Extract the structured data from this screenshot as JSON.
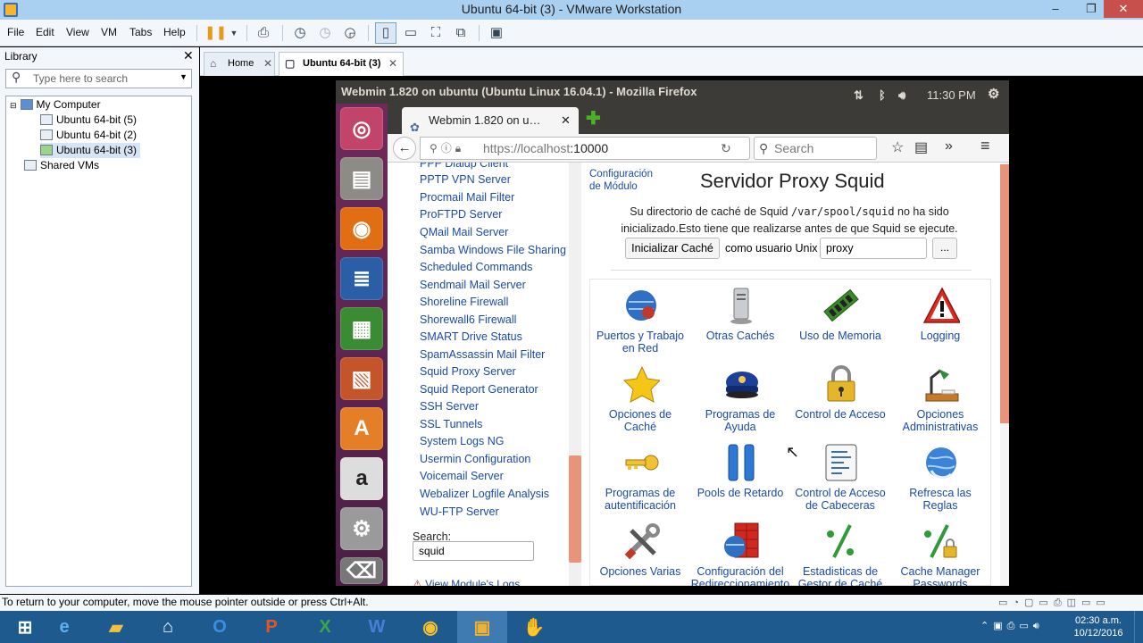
{
  "vmware": {
    "title": "Ubuntu 64-bit (3) - VMware Workstation",
    "menu": [
      "File",
      "Edit",
      "View",
      "VM",
      "Tabs",
      "Help"
    ],
    "library": {
      "header": "Library",
      "search_placeholder": "Type here to search",
      "tree": [
        "My Computer",
        "Ubuntu 64-bit (5)",
        "Ubuntu 64-bit (2)",
        "Ubuntu 64-bit (3)",
        "Shared VMs"
      ]
    },
    "tabs": [
      {
        "label": "Home"
      },
      {
        "label": "Ubuntu 64-bit (3)"
      }
    ],
    "status": "To return to your computer, move the mouse pointer outside or press Ctrl+Alt."
  },
  "guest": {
    "window_title": "Webmin 1.820 on ubuntu (Ubuntu Linux 16.04.1) - Mozilla Firefox",
    "time": "11:30 PM",
    "tab_title": "Webmin 1.820 on u…",
    "url_host": "https://localhost",
    "url_port": ":10000",
    "search_placeholder": "Search"
  },
  "webmin": {
    "modules": [
      "PPP Dialup Client",
      "PPTP VPN Server",
      "Procmail Mail Filter",
      "ProFTPD Server",
      "QMail Mail Server",
      "Samba Windows File Sharing",
      "Scheduled Commands",
      "Sendmail Mail Server",
      "Shoreline Firewall",
      "Shorewall6 Firewall",
      "SMART Drive Status",
      "SpamAssassin Mail Filter",
      "Squid Proxy Server",
      "Squid Report Generator",
      "SSH Server",
      "SSL Tunnels",
      "System Logs NG",
      "Usermin Configuration",
      "Voicemail Server",
      "Webalizer Logfile Analysis",
      "WU-FTP Server"
    ],
    "search_label": "Search:",
    "search_value": "squid",
    "view_logs": "View Module's Logs",
    "config_link_1": "Configuración",
    "config_link_2": "de Módulo",
    "page_title": "Servidor Proxy Squid",
    "warning_1": "Su directorio de caché de Squid",
    "warning_path": "/var/spool/squid",
    "warning_2": "no ha sido inicializado.Esto tiene que realizarse antes de que Squid se ejecute.",
    "init_button": "Inicializar Caché",
    "as_user": "como usuario Unix",
    "user_value": "proxy",
    "dots": "...",
    "icons": [
      {
        "l1": "Puertos y Trabajo",
        "l2": "en Red",
        "icon": "network-icon"
      },
      {
        "l1": "Otras Cachés",
        "l2": "",
        "icon": "server-icon"
      },
      {
        "l1": "Uso de Memoria",
        "l2": "",
        "icon": "memory-icon"
      },
      {
        "l1": "Logging",
        "l2": "",
        "icon": "warning-icon"
      },
      {
        "l1": "Opciones de",
        "l2": "Caché",
        "icon": "star-icon"
      },
      {
        "l1": "Programas de",
        "l2": "Ayuda",
        "icon": "police-hat-icon"
      },
      {
        "l1": "Control de Acceso",
        "l2": "",
        "icon": "lock-icon"
      },
      {
        "l1": "Opciones",
        "l2": "Administrativas",
        "icon": "desk-lamp-icon"
      },
      {
        "l1": "Programas de",
        "l2": "autentificación",
        "icon": "key-icon"
      },
      {
        "l1": "Pools de Retardo",
        "l2": "",
        "icon": "pause-pools-icon"
      },
      {
        "l1": "Control de Acceso",
        "l2": "de Cabeceras",
        "icon": "document-icon"
      },
      {
        "l1": "Refresca las",
        "l2": "Reglas",
        "icon": "globe-refresh-icon"
      },
      {
        "l1": "Opciones Varias",
        "l2": "",
        "icon": "tools-icon"
      },
      {
        "l1": "Configuración del",
        "l2": "Redireccionamiento",
        "icon": "redirect-icon"
      },
      {
        "l1": "Estadisticas de",
        "l2": "Gestor de Caché",
        "icon": "stats-icon"
      },
      {
        "l1": "Cache Manager",
        "l2": "Passwords",
        "icon": "cache-lock-icon"
      }
    ]
  },
  "taskbar": {
    "time": "02:30 a.m.",
    "date": "10/12/2016"
  }
}
